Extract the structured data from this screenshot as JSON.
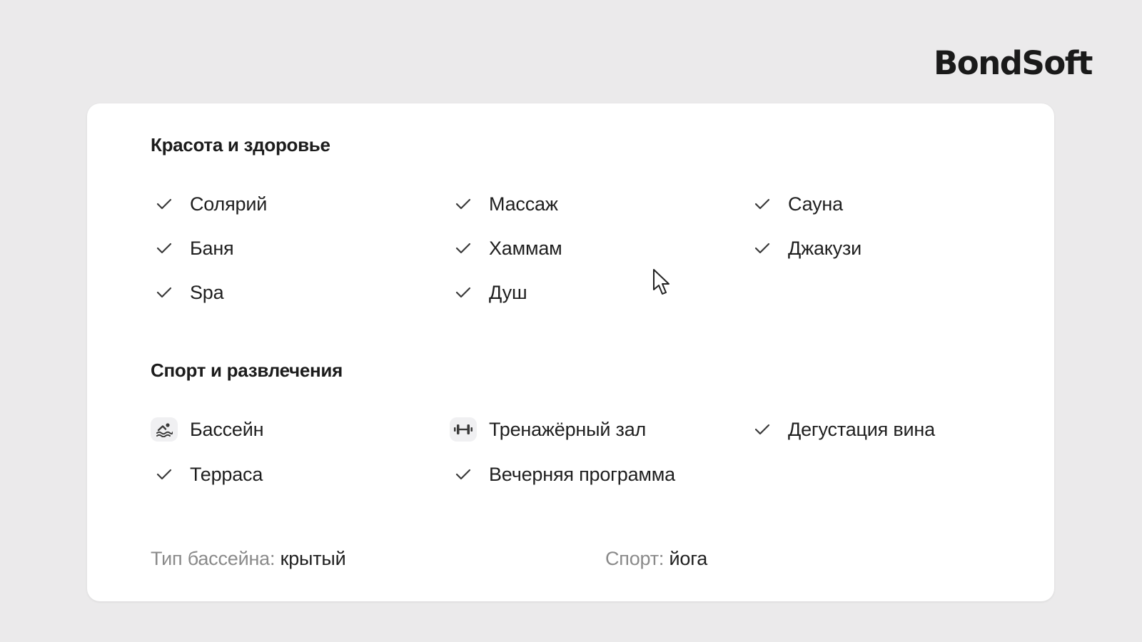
{
  "brand": {
    "name": "BondSoft"
  },
  "sections": [
    {
      "title": "Красота и здоровье",
      "items": [
        {
          "label": "Солярий",
          "icon": "check-icon"
        },
        {
          "label": "Массаж",
          "icon": "check-icon"
        },
        {
          "label": "Сауна",
          "icon": "check-icon"
        },
        {
          "label": "Баня",
          "icon": "check-icon"
        },
        {
          "label": "Хаммам",
          "icon": "check-icon"
        },
        {
          "label": "Джакузи",
          "icon": "check-icon"
        },
        {
          "label": "Spa",
          "icon": "check-icon"
        },
        {
          "label": "Душ",
          "icon": "check-icon"
        }
      ]
    },
    {
      "title": "Спорт и развлечения",
      "items": [
        {
          "label": "Бассейн",
          "icon": "swimmer-icon"
        },
        {
          "label": "Тренажёрный зал",
          "icon": "dumbbell-icon"
        },
        {
          "label": "Дегустация вина",
          "icon": "check-icon"
        },
        {
          "label": "Терраса",
          "icon": "check-icon"
        },
        {
          "label": "Вечерняя программа",
          "icon": "check-icon"
        }
      ]
    }
  ],
  "details": {
    "pool_type_key": "Тип бассейна:",
    "pool_type_value": "крытый",
    "sport_key": "Спорт:",
    "sport_value": "йога"
  },
  "colors": {
    "background": "#ebeaeb",
    "card": "#ffffff",
    "text": "#1f1f1f",
    "muted": "#8a8a8a",
    "check": "#3a3a3a"
  }
}
